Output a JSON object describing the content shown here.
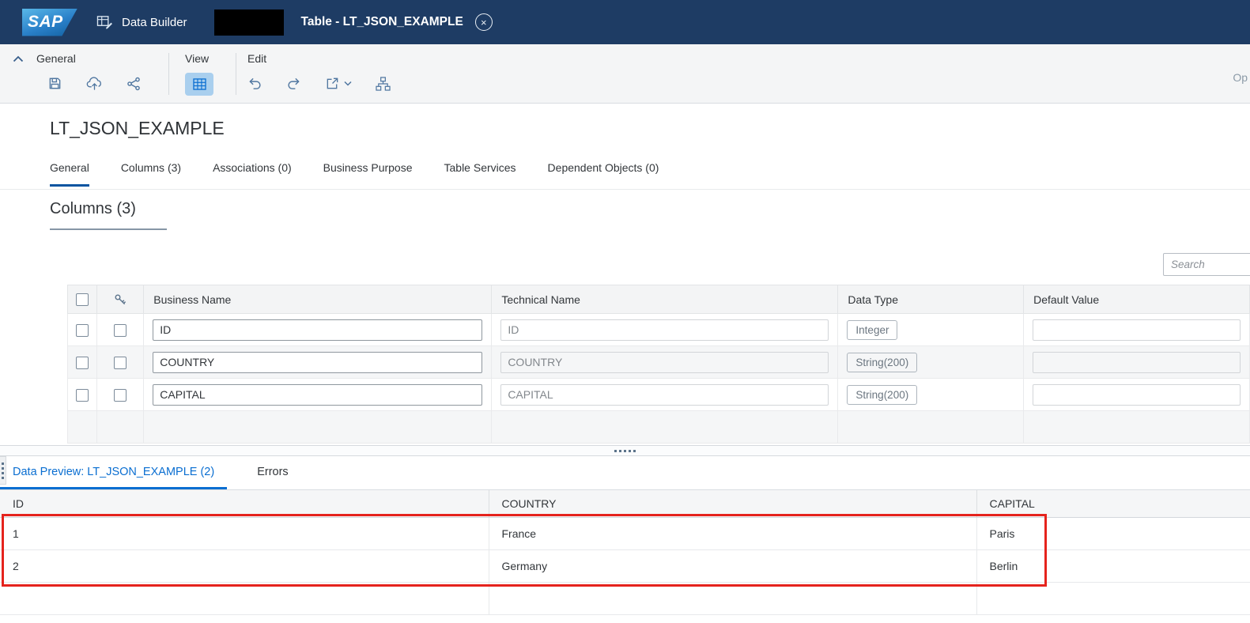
{
  "shell": {
    "logo_text": "SAP",
    "app_title": "Data Builder",
    "document_tab_title": "Table - LT_JSON_EXAMPLE"
  },
  "toolbar": {
    "general_group_label": "General",
    "view_group_label": "View",
    "edit_group_label": "Edit",
    "right_cut_text": "Op",
    "icons": [
      "save",
      "deploy-cloud",
      "share",
      "table-view-toggle",
      "undo",
      "redo",
      "export-with-menu",
      "hierarchy"
    ]
  },
  "page": {
    "title": "LT_JSON_EXAMPLE",
    "tabs": [
      {
        "label": "General",
        "active": true
      },
      {
        "label": "Columns (3)",
        "active": false
      },
      {
        "label": "Associations (0)",
        "active": false
      },
      {
        "label": "Business Purpose",
        "active": false
      },
      {
        "label": "Table Services",
        "active": false
      },
      {
        "label": "Dependent Objects (0)",
        "active": false
      }
    ],
    "section_title": "Columns (3)",
    "search_placeholder": "Search"
  },
  "columns_table": {
    "headers": {
      "business_name": "Business Name",
      "technical_name": "Technical Name",
      "data_type": "Data Type",
      "default_value": "Default Value"
    },
    "rows": [
      {
        "business_name": "ID",
        "technical_name": "ID",
        "data_type": "Integer",
        "default_value": ""
      },
      {
        "business_name": "COUNTRY",
        "technical_name": "COUNTRY",
        "data_type": "String(200)",
        "default_value": ""
      },
      {
        "business_name": "CAPITAL",
        "technical_name": "CAPITAL",
        "data_type": "String(200)",
        "default_value": ""
      }
    ]
  },
  "preview_panel": {
    "tabs": [
      {
        "label": "Data Preview: LT_JSON_EXAMPLE (2)",
        "active": true
      },
      {
        "label": "Errors",
        "active": false
      }
    ],
    "headers": [
      "ID",
      "COUNTRY",
      "CAPITAL"
    ],
    "rows": [
      [
        "1",
        "France",
        "Paris"
      ],
      [
        "2",
        "Germany",
        "Berlin"
      ]
    ]
  },
  "colors": {
    "shell_bg": "#1e3c64",
    "accent_blue": "#0a6ed1",
    "tab_underline": "#0854a0",
    "toolbar_icon": "#4f76a0",
    "annotation_red": "#e5231d"
  }
}
